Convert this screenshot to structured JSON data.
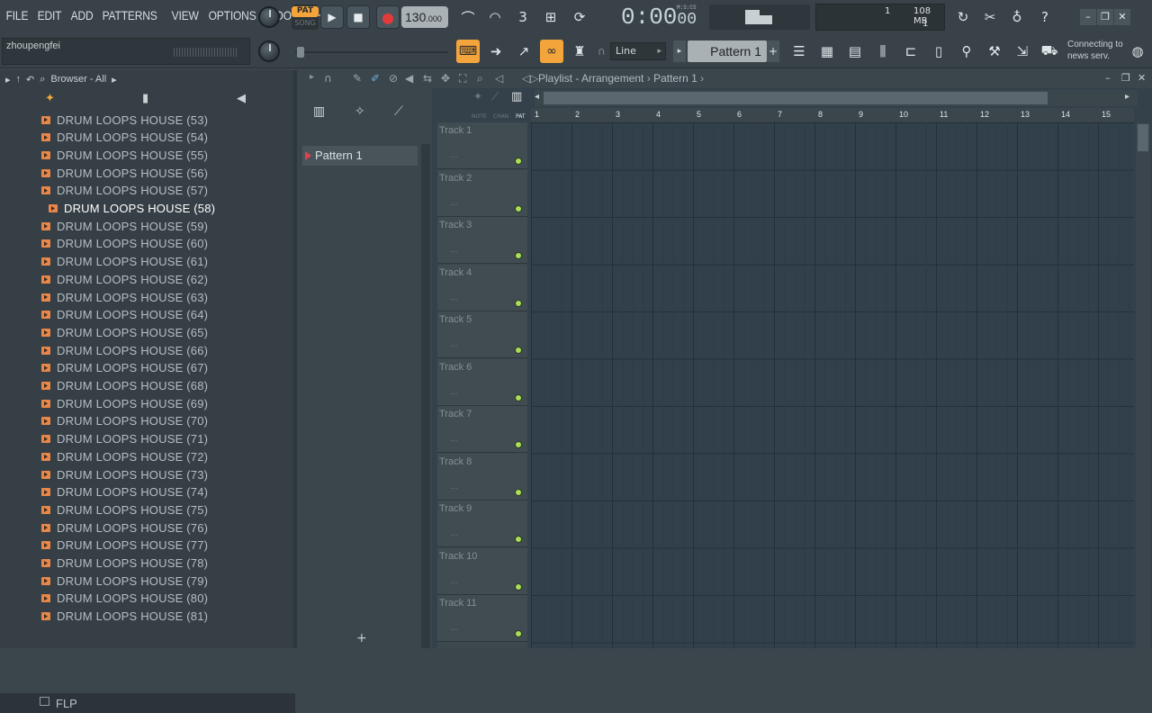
{
  "menu": [
    "FILE",
    "EDIT",
    "ADD",
    "PATTERNS",
    "VIEW",
    "OPTIONS",
    "TOOLS",
    "HELP"
  ],
  "hint": "zhoupengfei",
  "transport": {
    "pat": "PAT",
    "song": "SONG",
    "tempo": "130",
    "tempo_frac": ".000"
  },
  "time": {
    "main": "0:00",
    "cs": "00",
    "label": "M:S:CS"
  },
  "cpu": {
    "a": "1",
    "mem": "108 MB",
    "b": "1"
  },
  "pattern_select": "Pattern 1",
  "snap": "Line",
  "news": "Connecting to news serv.",
  "browser": {
    "title": "Browser - All",
    "items": [
      "DRUM LOOPS HOUSE (53)",
      "DRUM LOOPS HOUSE (54)",
      "DRUM LOOPS HOUSE (55)",
      "DRUM LOOPS HOUSE (56)",
      "DRUM LOOPS HOUSE (57)",
      "DRUM LOOPS HOUSE (58)",
      "DRUM LOOPS HOUSE (59)",
      "DRUM LOOPS HOUSE (60)",
      "DRUM LOOPS HOUSE (61)",
      "DRUM LOOPS HOUSE (62)",
      "DRUM LOOPS HOUSE (63)",
      "DRUM LOOPS HOUSE (64)",
      "DRUM LOOPS HOUSE (65)",
      "DRUM LOOPS HOUSE (66)",
      "DRUM LOOPS HOUSE (67)",
      "DRUM LOOPS HOUSE (68)",
      "DRUM LOOPS HOUSE (69)",
      "DRUM LOOPS HOUSE (70)",
      "DRUM LOOPS HOUSE (71)",
      "DRUM LOOPS HOUSE (72)",
      "DRUM LOOPS HOUSE (73)",
      "DRUM LOOPS HOUSE (74)",
      "DRUM LOOPS HOUSE (75)",
      "DRUM LOOPS HOUSE (76)",
      "DRUM LOOPS HOUSE (77)",
      "DRUM LOOPS HOUSE (78)",
      "DRUM LOOPS HOUSE (79)",
      "DRUM LOOPS HOUSE (80)",
      "DRUM LOOPS HOUSE (81)"
    ],
    "selected_index": 5,
    "folder": "FLP"
  },
  "playlist": {
    "title": "Playlist - Arrangement",
    "pattern": "Pattern 1",
    "picker_item": "Pattern 1",
    "col_labels": [
      "NOTE",
      "CHAN",
      "PAT"
    ],
    "tracks": [
      "Track 1",
      "Track 2",
      "Track 3",
      "Track 4",
      "Track 5",
      "Track 6",
      "Track 7",
      "Track 8",
      "Track 9",
      "Track 10",
      "Track 11"
    ],
    "bars": [
      "1",
      "2",
      "3",
      "4",
      "5",
      "6",
      "7",
      "8",
      "9",
      "10",
      "11",
      "12",
      "13",
      "14",
      "15"
    ]
  },
  "colors": {
    "accent": "#f3a53b",
    "folder": "#e8874a",
    "led": "#a8e05a",
    "record": "#e23a3a"
  }
}
